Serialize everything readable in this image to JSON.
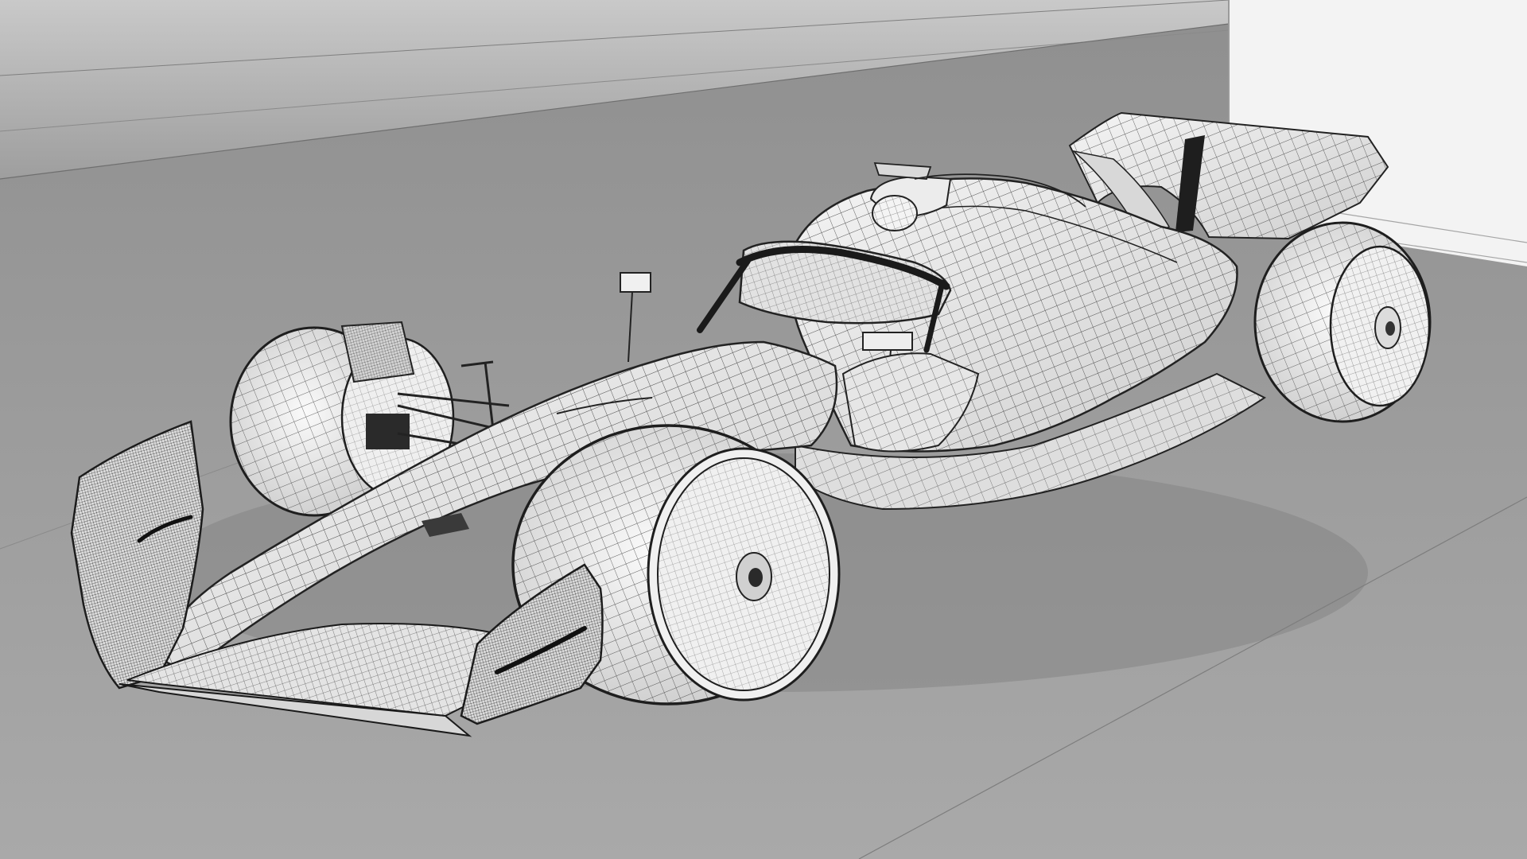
{
  "scene": {
    "subject": "race-car-wireframe",
    "style": "grey-shaded-wireframe",
    "colors": {
      "backdrop_top": "#bcbcbc",
      "floor": "#9c9c9c",
      "wall_panel": "#f2f2f2",
      "body_fill": "#e8e8e8",
      "tyre_fill": "#eeeeee",
      "mesh_line": "#222222",
      "shadow": "#7a7a7a"
    },
    "icons": []
  }
}
